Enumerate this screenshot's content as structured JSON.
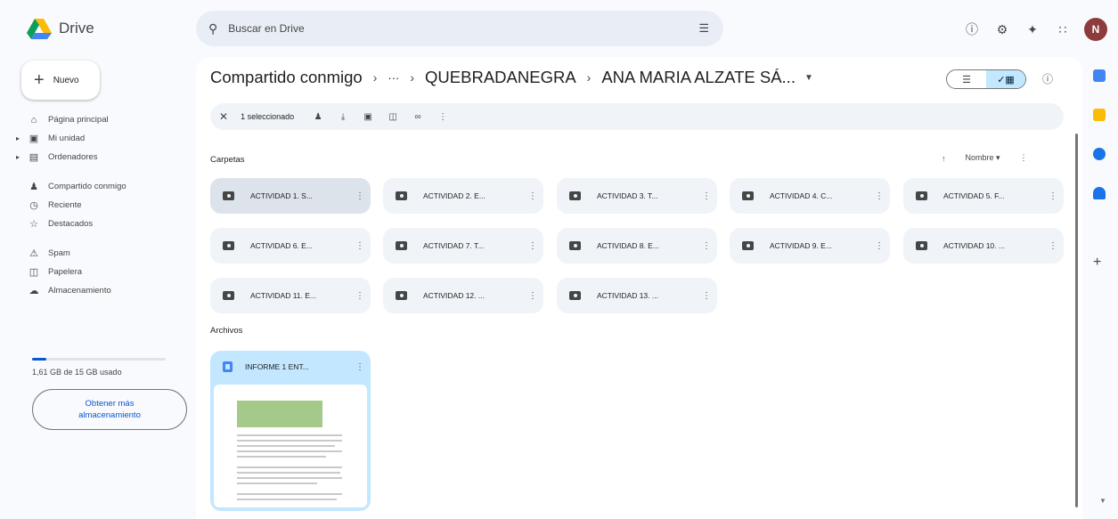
{
  "header": {
    "app_name": "Drive",
    "search_placeholder": "Buscar en Drive",
    "avatar_letter": "N"
  },
  "sidebar": {
    "new_label": "Nuevo",
    "items": [
      {
        "label": "Página principal",
        "icon": "home-icon"
      },
      {
        "label": "Mi unidad",
        "icon": "drive-icon"
      },
      {
        "label": "Ordenadores",
        "icon": "computer-icon"
      },
      {
        "label": "Compartido conmigo",
        "icon": "people-icon"
      },
      {
        "label": "Reciente",
        "icon": "clock-icon"
      },
      {
        "label": "Destacados",
        "icon": "star-icon"
      },
      {
        "label": "Spam",
        "icon": "spam-icon"
      },
      {
        "label": "Papelera",
        "icon": "trash-icon"
      },
      {
        "label": "Almacenamiento",
        "icon": "cloud-icon"
      }
    ],
    "storage_used_fraction": 0.107,
    "storage_text": "1,61 GB de 15 GB usado",
    "get_more_label": "Obtener más almacenamiento"
  },
  "breadcrumb": {
    "root": "Compartido conmigo",
    "ellipsis": "···",
    "middle": "QUEBRADANEGRA",
    "current": "ANA MARIA ALZATE SÁ..."
  },
  "selection_bar": {
    "count_text": "1 seleccionado"
  },
  "sections": {
    "folders_label": "Carpetas",
    "files_label": "Archivos",
    "sort_label": "Nombre"
  },
  "folders": [
    "ACTIVIDAD 1. S...",
    "ACTIVIDAD 2. E...",
    "ACTIVIDAD 3. T...",
    "ACTIVIDAD 4. C...",
    "ACTIVIDAD 5. F...",
    "ACTIVIDAD 6. E...",
    "ACTIVIDAD 7. T...",
    "ACTIVIDAD 8. E...",
    "ACTIVIDAD 9. E...",
    "ACTIVIDAD 10. ...",
    "ACTIVIDAD 11. E...",
    "ACTIVIDAD 12. ...",
    "ACTIVIDAD 13. ..."
  ],
  "files": [
    {
      "name": "INFORME 1 ENT..."
    }
  ],
  "colors": {
    "accent": "#0b57d0",
    "selected_bg": "#c2e7ff",
    "surface": "#f0f4f9"
  }
}
